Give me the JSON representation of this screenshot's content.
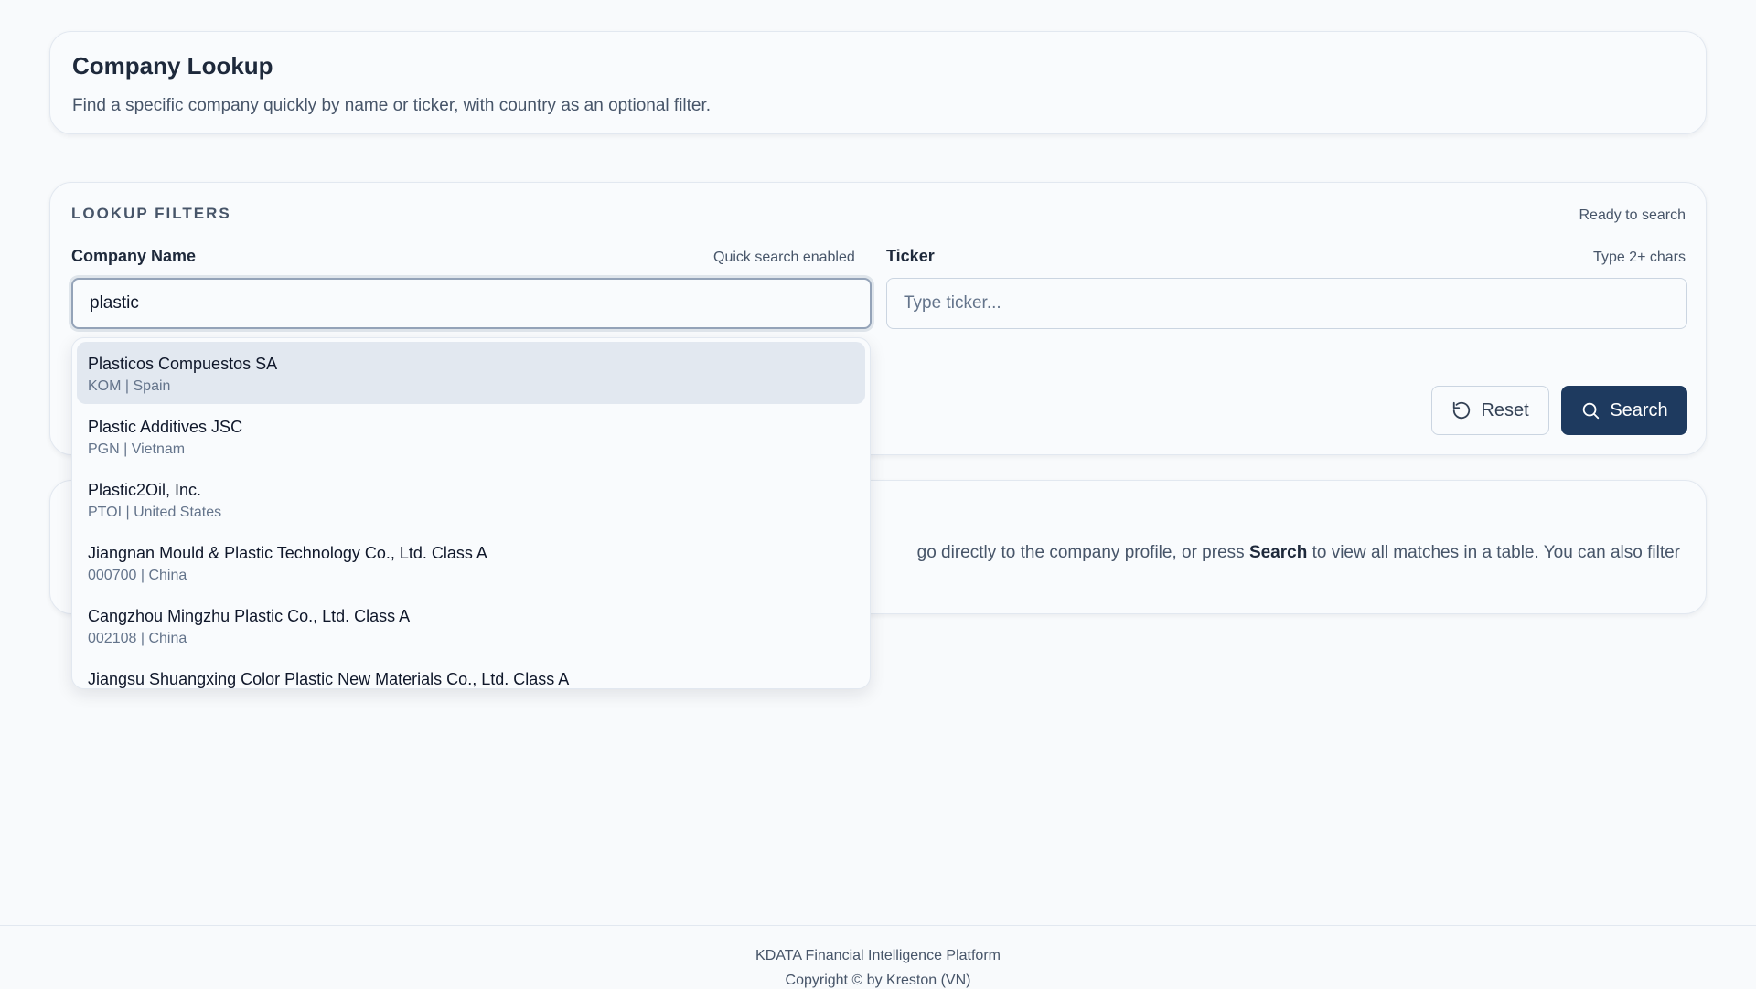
{
  "header": {
    "title": "Company Lookup",
    "subtitle": "Find a specific company quickly by name or ticker, with country as an optional filter."
  },
  "filters": {
    "section_title": "LOOKUP FILTERS",
    "status": "Ready to search",
    "company": {
      "label": "Company Name",
      "hint": "Quick search enabled",
      "value": "plastic"
    },
    "ticker": {
      "label": "Ticker",
      "hint": "Type 2+ chars",
      "value": "",
      "placeholder": "Type ticker..."
    },
    "reset_label": "Reset",
    "search_label": "Search"
  },
  "suggestions": [
    {
      "name": "Plasticos Compuestos SA",
      "meta": "KOM | Spain"
    },
    {
      "name": "Plastic Additives JSC",
      "meta": "PGN | Vietnam"
    },
    {
      "name": "Plastic2Oil, Inc.",
      "meta": "PTOI | United States"
    },
    {
      "name": "Jiangnan Mould & Plastic Technology Co., Ltd. Class A",
      "meta": "000700 | China"
    },
    {
      "name": "Cangzhou Mingzhu Plastic Co., Ltd. Class A",
      "meta": "002108 | China"
    },
    {
      "name": "Jiangsu Shuangxing Color Plastic New Materials Co., Ltd. Class A",
      "meta": ""
    }
  ],
  "info": {
    "text_before": "go directly to the company profile, or press ",
    "text_bold": "Search",
    "text_after": " to view all matches in a table. You can also filter"
  },
  "footer": {
    "line1": "KDATA Financial Intelligence Platform",
    "line2": "Copyright © by Kreston (VN)"
  }
}
